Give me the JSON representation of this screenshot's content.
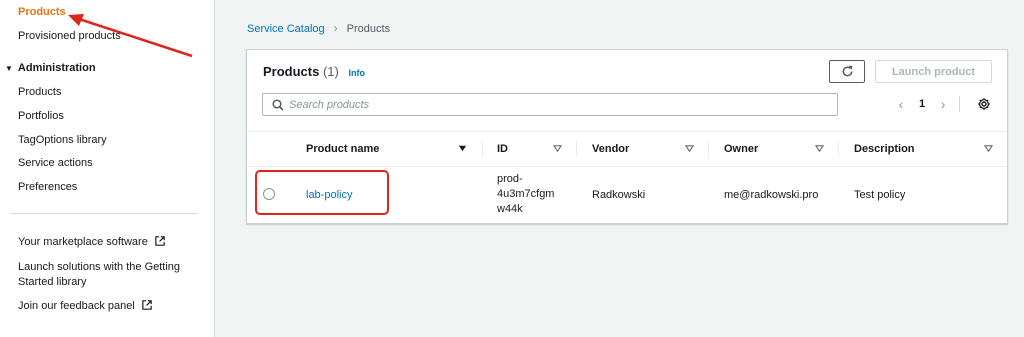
{
  "sidebar": {
    "top_items": [
      "Products",
      "Provisioned products"
    ],
    "admin_section": "Administration",
    "admin_items": [
      "Products",
      "Portfolios",
      "TagOptions library",
      "Service actions",
      "Preferences"
    ],
    "links": {
      "marketplace": "Your marketplace software",
      "getting_started_1": "Launch solutions with the Getting",
      "getting_started_2": "Started library",
      "feedback": "Join our feedback panel"
    }
  },
  "breadcrumb": {
    "parent": "Service Catalog",
    "current": "Products"
  },
  "panel": {
    "title": "Products",
    "count": "(1)",
    "info": "Info",
    "launch_label": "Launch product",
    "search_placeholder": "Search products",
    "page": "1"
  },
  "table": {
    "columns": [
      "Product name",
      "ID",
      "Vendor",
      "Owner",
      "Description"
    ],
    "rows": [
      {
        "name": "lab-policy",
        "id_lines": [
          "prod-",
          "4u3m7cfgm",
          "w44k"
        ],
        "vendor": "Radkowski",
        "owner": "me@radkowski.pro",
        "description": "Test policy"
      }
    ]
  },
  "colors": {
    "accent": "#ec7211",
    "link": "#0073bb",
    "annotation": "#e0241b"
  }
}
